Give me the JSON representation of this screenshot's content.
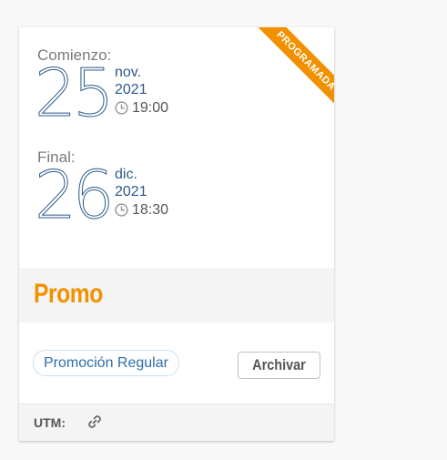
{
  "ribbon": {
    "label": "PROGRAMADA",
    "color": "#f29100"
  },
  "start": {
    "label": "Comienzo:",
    "day": "25",
    "month": "nov.",
    "year": "2021",
    "time": "19:00",
    "icon": "clock-icon"
  },
  "end": {
    "label": "Final:",
    "day": "26",
    "month": "dic.",
    "year": "2021",
    "time": "18:30",
    "icon": "clock-icon"
  },
  "title": {
    "text": "Promo",
    "color": "#f29100"
  },
  "tag": {
    "label": "Promoción Regular"
  },
  "actions": {
    "archive_label": "Archivar"
  },
  "footer": {
    "utm_label": "UTM:",
    "icon": "link-icon"
  },
  "colors": {
    "accent": "#f29100",
    "date_blue": "#2b5a8a",
    "tag_blue": "#2d6ea8"
  }
}
